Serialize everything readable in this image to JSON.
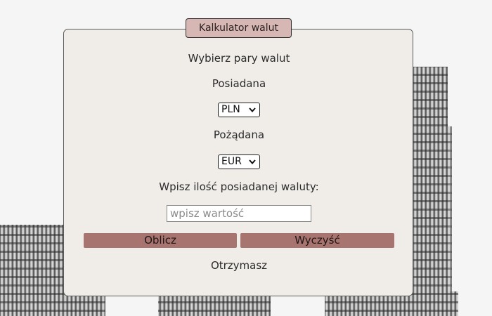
{
  "form": {
    "legend": "Kalkulator walut",
    "heading": "Wybierz pary walut",
    "have_label": "Posiadana",
    "have_value": "PLN",
    "want_label": "Pożądana",
    "want_value": "EUR",
    "amount_label": "Wpisz ilość posiadanej waluty:",
    "amount_placeholder": "wpisz wartość",
    "calculate_label": "Oblicz",
    "clear_label": "Wyczyść",
    "result_label": "Otrzymasz"
  },
  "icons": {
    "select_arrow": "chevron-down-icon"
  },
  "colors": {
    "card_background": "#f0ede9",
    "legend_background": "#d6b7b4",
    "button_background": "#a77470"
  }
}
